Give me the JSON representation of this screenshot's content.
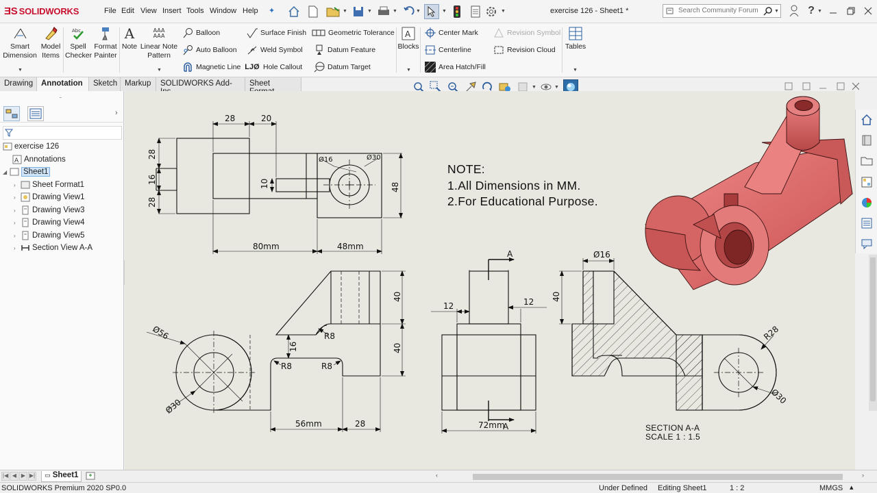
{
  "app": {
    "logo": "SOLIDWORKS",
    "document_title": "exercise 126 - Sheet1 *"
  },
  "menu": [
    "File",
    "Edit",
    "View",
    "Insert",
    "Tools",
    "Window",
    "Help"
  ],
  "search": {
    "placeholder": "Search Community Forum"
  },
  "ribbon": {
    "smart_dimension": "Smart\nDimension",
    "model_items": "Model\nItems",
    "spell_checker": "Spell\nChecker",
    "format_painter": "Format\nPainter",
    "note": "Note",
    "linear_note_pattern": "Linear Note\nPattern",
    "balloon": "Balloon",
    "auto_balloon": "Auto Balloon",
    "magnetic_line": "Magnetic Line",
    "surface_finish": "Surface Finish",
    "weld_symbol": "Weld Symbol",
    "hole_callout": "Hole Callout",
    "geometric_tolerance": "Geometric Tolerance",
    "datum_feature": "Datum Feature",
    "datum_target": "Datum Target",
    "blocks": "Blocks",
    "center_mark": "Center Mark",
    "centerline": "Centerline",
    "area_hatch_fill": "Area Hatch/Fill",
    "revision_symbol": "Revision Symbol",
    "revision_cloud": "Revision Cloud",
    "tables": "Tables"
  },
  "tabs": [
    "Drawing",
    "Annotation",
    "Sketch",
    "Markup",
    "SOLIDWORKS Add-Ins",
    "Sheet Format"
  ],
  "active_tab": "Annotation",
  "tree": {
    "root": "exercise 126",
    "items": [
      "Annotations",
      "Sheet1",
      "Sheet Format1",
      "Drawing View1",
      "Drawing View3",
      "Drawing View4",
      "Drawing View5",
      "Section View A-A"
    ]
  },
  "note": {
    "heading": "NOTE:",
    "line1": "1.All Dimensions in MM.",
    "line2": "2.For Educational Purpose."
  },
  "section": {
    "title": "SECTION A-A",
    "scale": "SCALE 1 : 1.5"
  },
  "dimensions": {
    "top_28": "28",
    "top_20": "20",
    "left_28a": "28",
    "left_16": "16",
    "left_28b": "28",
    "slot_10": "10",
    "hole_16": "Ø16",
    "hole_30": "Ø30",
    "right_48": "48",
    "bottom_80": "80mm",
    "bottom_48": "48mm",
    "front_56": "Ø56",
    "front_30": "Ø30",
    "front_16": "16",
    "front_r8a": "R8",
    "front_r8b": "R8",
    "front_r8c": "R8",
    "front_40a": "40",
    "front_40b": "40",
    "front_56mm": "56mm",
    "front_28": "28",
    "side_a": "A",
    "side_a2": "A",
    "side_12a": "12",
    "side_12b": "12",
    "side_72": "72mm",
    "sec_16": "Ø16",
    "sec_40": "40",
    "sec_r28": "R28",
    "sec_30": "Ø30"
  },
  "sheet_tab": "Sheet1",
  "status": {
    "product": "SOLIDWORKS Premium 2020 SP0.0",
    "definition": "Under Defined",
    "mode": "Editing Sheet1",
    "scale": "1 : 2",
    "units": "MMGS"
  },
  "colors": {
    "accent_red": "#c8102e",
    "part_color": "#e07474",
    "sheet_bg": "#e8e8e0"
  }
}
